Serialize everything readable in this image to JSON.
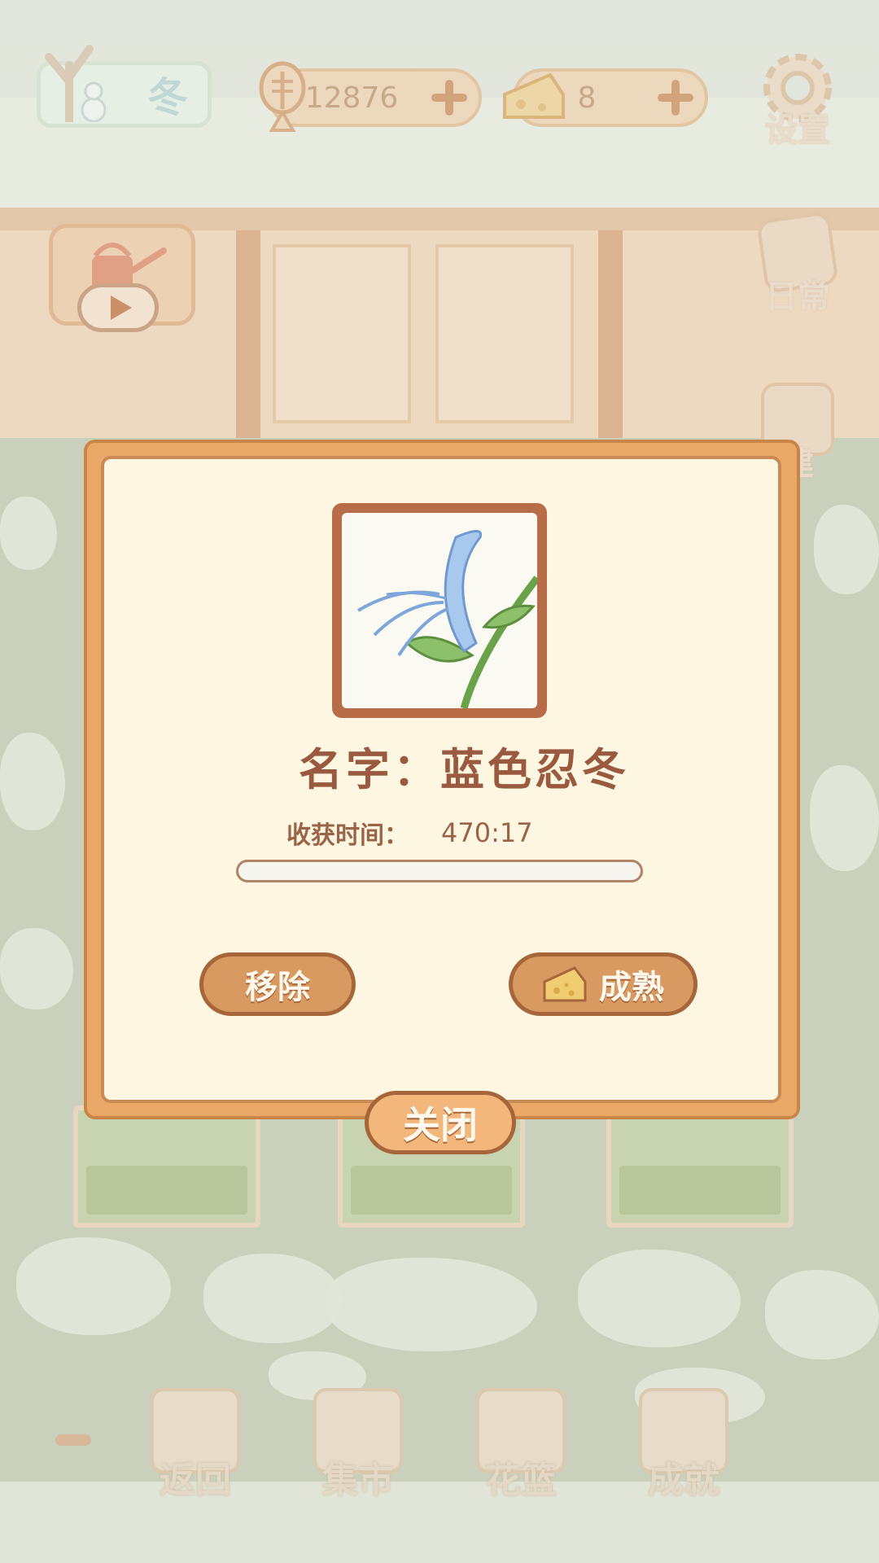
{
  "hud": {
    "season_label": "冬",
    "fish_count": "12876",
    "cheese_count": "8"
  },
  "side_menu": {
    "settings_label": "设置",
    "daily_label": "日常",
    "build_label": "建"
  },
  "bottom_nav": {
    "back_label": "返回",
    "market_label": "集市",
    "basket_label": "花篮",
    "achievement_label": "成就"
  },
  "dialog": {
    "name_text": "名字：蓝色忍冬",
    "harvest_time_label": "收获时间：",
    "harvest_time_value": "470:17",
    "growth_progress": 0.0,
    "remove_label": "移除",
    "mature_label": "成熟",
    "close_label": "关闭"
  },
  "colors": {
    "dialog_border": "#e9a868",
    "dialog_bg": "#fdf6e1",
    "button_fill": "#d99a62",
    "text_brown": "#9a5a40"
  }
}
